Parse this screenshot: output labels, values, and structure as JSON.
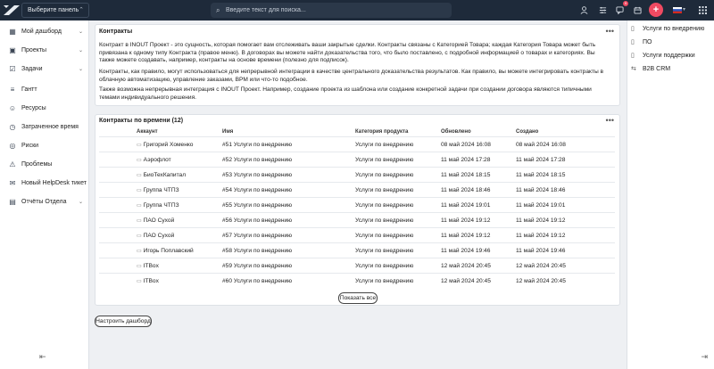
{
  "topbar": {
    "panel_select": "Выберите панель",
    "search_placeholder": "Введите текст для поиска...",
    "notification_count": "9"
  },
  "sidebar": {
    "items": [
      {
        "label": "Мой дашборд",
        "icon": "dashboard-icon",
        "has_chevron": true
      },
      {
        "label": "Проекты",
        "icon": "briefcase-icon",
        "has_chevron": true
      },
      {
        "label": "Задачи",
        "icon": "tasks-icon",
        "has_chevron": true
      },
      {
        "label": "Гантт",
        "icon": "gantt-icon",
        "has_chevron": false
      },
      {
        "label": "Ресурсы",
        "icon": "users-icon",
        "has_chevron": false
      },
      {
        "label": "Затраченное время",
        "icon": "clock-icon",
        "has_chevron": false
      },
      {
        "label": "Риски",
        "icon": "risk-icon",
        "has_chevron": false
      },
      {
        "label": "Проблемы",
        "icon": "problem-icon",
        "has_chevron": false
      },
      {
        "label": "Новый HelpDesk тикет",
        "icon": "ticket-icon",
        "has_chevron": false
      },
      {
        "label": "Отчёты Отдела",
        "icon": "reports-icon",
        "has_chevron": true
      }
    ]
  },
  "right_panel": {
    "links": [
      {
        "label": "Услуги по внедрению",
        "icon": "document-icon"
      },
      {
        "label": "ПО",
        "icon": "document-icon"
      },
      {
        "label": "Услуги поддержки",
        "icon": "document-icon"
      },
      {
        "label": "B2B CRM",
        "icon": "arrows-icon"
      }
    ]
  },
  "info_card": {
    "title": "Контракты",
    "paragraphs": [
      "Контракт в INOUT Проект - это сущность, которая помогает вам отслеживать ваши закрытые сделки. Контракты связаны с Категорией Товара; каждая Категория Товара может быть привязана к одному типу Контракта (правое меню). В договорах вы можете найти доказательства того, что было поставлено, с подробной информацией о товарах и категориях. Вы также можете создавать, например, контракты на основе времени (полезно для подписок).",
      "Контракты, как правило, могут использоваться для непрерывной интеграции в качестве центрального доказательства результатов. Как правило, вы можете интегрировать контракты в облачную автоматизацию, управление заказами, BPM или что-то подобное.",
      "Также возможна непрерывная интеграция с INOUT Проект. Например, создание проекта из шаблона или создание конкретной задачи при создании договора являются типичными темами индивидуального решения."
    ]
  },
  "table_card": {
    "title": "Контракты по времени (12)",
    "columns": [
      "Аккаунт",
      "Имя",
      "Категория продукта",
      "Обновлено",
      "Создано"
    ],
    "rows": [
      [
        "Григорий Хоменко",
        "#51 Услуги по внедрению",
        "Услуги по внедрению",
        "08 май 2024 16:08",
        "08 май 2024 16:08"
      ],
      [
        "Аэрофлот",
        "#52 Услуги по внедрению",
        "Услуги по внедрению",
        "11 май 2024 17:28",
        "11 май 2024 17:28"
      ],
      [
        "БиоТехКапитал",
        "#53 Услуги по внедрению",
        "Услуги по внедрению",
        "11 май 2024 18:15",
        "11 май 2024 18:15"
      ],
      [
        "Группа ЧТПЗ",
        "#54 Услуги по внедрению",
        "Услуги по внедрению",
        "11 май 2024 18:46",
        "11 май 2024 18:46"
      ],
      [
        "Группа ЧТПЗ",
        "#55 Услуги по внедрению",
        "Услуги по внедрению",
        "11 май 2024 19:01",
        "11 май 2024 19:01"
      ],
      [
        "ПАО Сухой",
        "#56 Услуги по внедрению",
        "Услуги по внедрению",
        "11 май 2024 19:12",
        "11 май 2024 19:12"
      ],
      [
        "ПАО Сухой",
        "#57 Услуги по внедрению",
        "Услуги по внедрению",
        "11 май 2024 19:12",
        "11 май 2024 19:12"
      ],
      [
        "Игорь Поплавский",
        "#58 Услуги по внедрению",
        "Услуги по внедрению",
        "11 май 2024 19:46",
        "11 май 2024 19:46"
      ],
      [
        "ITBox",
        "#59 Услуги по внедрению",
        "Услуги по внедрению",
        "12 май 2024 20:45",
        "12 май 2024 20:45"
      ],
      [
        "ITBox",
        "#60 Услуги по внедрению",
        "Услуги по внедрению",
        "12 май 2024 20:45",
        "12 май 2024 20:45"
      ]
    ],
    "show_all": "Показать все"
  },
  "setup_button": "Настроить дашборд",
  "colors": {
    "topbar": "#1e2a3a",
    "accent": "#f04a62"
  }
}
